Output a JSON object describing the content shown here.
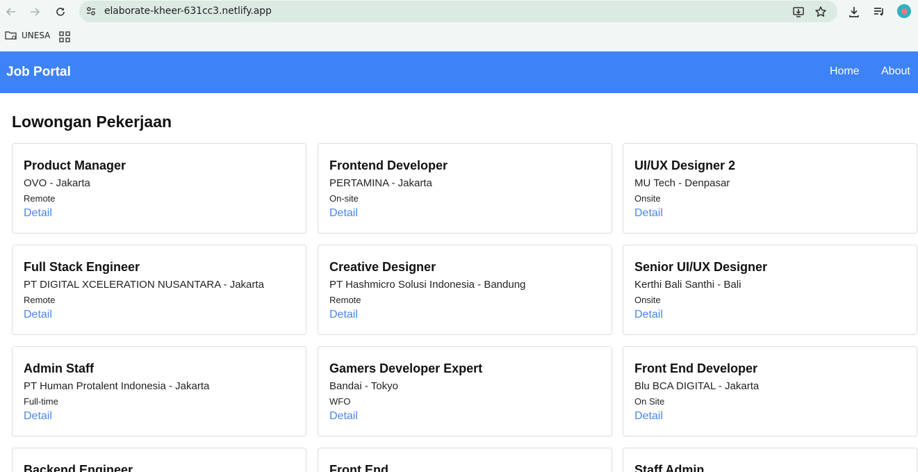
{
  "browser": {
    "url": "elaborate-kheer-631cc3.netlify.app",
    "bookmarks": [
      {
        "label": "UNESA"
      }
    ]
  },
  "navbar": {
    "brand": "Job Portal",
    "links": [
      "Home",
      "About"
    ],
    "color": "#3e82f7"
  },
  "main": {
    "title": "Lowongan Pekerjaan",
    "jobs": [
      {
        "title": "Product Manager",
        "company": "OVO - Jakarta",
        "type": "Remote",
        "link": "Detail"
      },
      {
        "title": "Frontend Developer",
        "company": "PERTAMINA - Jakarta",
        "type": "On-site",
        "link": "Detail"
      },
      {
        "title": "UI/UX Designer 2",
        "company": "MU Tech - Denpasar",
        "type": "Onsite",
        "link": "Detail"
      },
      {
        "title": "Full Stack Engineer",
        "company": "PT DIGITAL XCELERATION NUSANTARA - Jakarta",
        "type": "Remote",
        "link": "Detail"
      },
      {
        "title": "Creative Designer",
        "company": "PT Hashmicro Solusi Indonesia - Bandung",
        "type": "Remote",
        "link": "Detail"
      },
      {
        "title": "Senior UI/UX Designer",
        "company": "Kerthi Bali Santhi - Bali",
        "type": "Onsite",
        "link": "Detail"
      },
      {
        "title": "Admin Staff",
        "company": "PT Human Protalent Indonesia - Jakarta",
        "type": "Full-time",
        "link": "Detail"
      },
      {
        "title": "Gamers Developer Expert",
        "company": "Bandai - Tokyo",
        "type": "WFO",
        "link": "Detail"
      },
      {
        "title": "Front End Developer",
        "company": "Blu BCA DIGITAL - Jakarta",
        "type": "On Site",
        "link": "Detail"
      },
      {
        "title": "Backend Engineer",
        "company": "",
        "type": "",
        "link": ""
      },
      {
        "title": "Front End",
        "company": "",
        "type": "",
        "link": ""
      },
      {
        "title": "Staff Admin",
        "company": "",
        "type": "",
        "link": ""
      }
    ]
  }
}
